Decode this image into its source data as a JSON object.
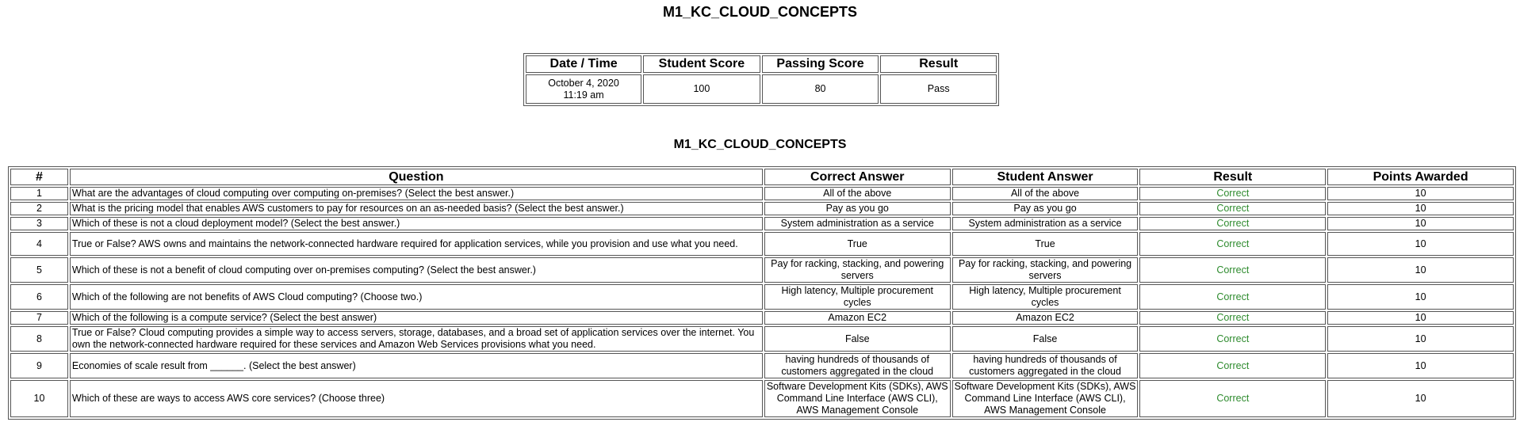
{
  "page": {
    "title": "M1_KC_CLOUD_CONCEPTS"
  },
  "summary": {
    "headers": [
      "Date / Time",
      "Student Score",
      "Passing Score",
      "Result"
    ],
    "date": "October 4, 2020",
    "time": "11:19 am",
    "student_score": "100",
    "passing_score": "80",
    "result": "Pass"
  },
  "section": {
    "title": "M1_KC_CLOUD_CONCEPTS"
  },
  "results": {
    "headers": [
      "#",
      "Question",
      "Correct Answer",
      "Student Answer",
      "Result",
      "Points Awarded"
    ],
    "rows": [
      {
        "num": "1",
        "question": "What are the advantages of cloud computing over computing on-premises? (Select the best answer.)",
        "correct": "All of the above",
        "student": "All of the above",
        "result": "Correct",
        "points": "10"
      },
      {
        "num": "2",
        "question": "What is the pricing model that enables AWS customers to pay for resources on an as-needed basis? (Select the best answer.)",
        "correct": "Pay as you go",
        "student": "Pay as you go",
        "result": "Correct",
        "points": "10"
      },
      {
        "num": "3",
        "question": "Which of these is not a cloud deployment model? (Select the best answer.)",
        "correct": "System administration as a service",
        "student": "System administration as a service",
        "result": "Correct",
        "points": "10"
      },
      {
        "num": "4",
        "question": "True or False? AWS owns and maintains the network-connected hardware required for application services, while you provision and use what you need.",
        "correct": "True",
        "student": "True",
        "result": "Correct",
        "points": "10"
      },
      {
        "num": "5",
        "question": "Which of these is not a benefit of cloud computing over on-premises computing? (Select the best answer.)",
        "correct": "Pay for racking, stacking, and powering servers",
        "student": "Pay for racking, stacking, and powering servers",
        "result": "Correct",
        "points": "10"
      },
      {
        "num": "6",
        "question": "Which of the following are not benefits of AWS Cloud computing? (Choose two.)",
        "correct": "High latency, Multiple procurement cycles",
        "student": "High latency, Multiple procurement cycles",
        "result": "Correct",
        "points": "10"
      },
      {
        "num": "7",
        "question": "Which of the following is a compute service? (Select the best answer)",
        "correct": "Amazon EC2",
        "student": "Amazon EC2",
        "result": "Correct",
        "points": "10"
      },
      {
        "num": "8",
        "question": "True or False? Cloud computing provides a simple way to access servers, storage, databases, and a broad set of application services over the internet. You own the network-connected hardware required for these services and Amazon Web Services provisions what you need.",
        "correct": "False",
        "student": "False",
        "result": "Correct",
        "points": "10"
      },
      {
        "num": "9",
        "question": "Economies of scale result from ______. (Select the best answer)",
        "correct": "having hundreds of thousands of customers aggregated in the cloud",
        "student": "having hundreds of thousands of customers aggregated in the cloud",
        "result": "Correct",
        "points": "10"
      },
      {
        "num": "10",
        "question": "Which of these are ways to access AWS core services? (Choose three)",
        "correct": "Software Development Kits (SDKs), AWS Command Line Interface (AWS CLI), AWS Management Console",
        "student": "Software Development Kits (SDKs), AWS Command Line Interface (AWS CLI), AWS Management Console",
        "result": "Correct",
        "points": "10"
      }
    ]
  },
  "colors": {
    "correct": "#2e8b2e",
    "border": "#555555"
  }
}
